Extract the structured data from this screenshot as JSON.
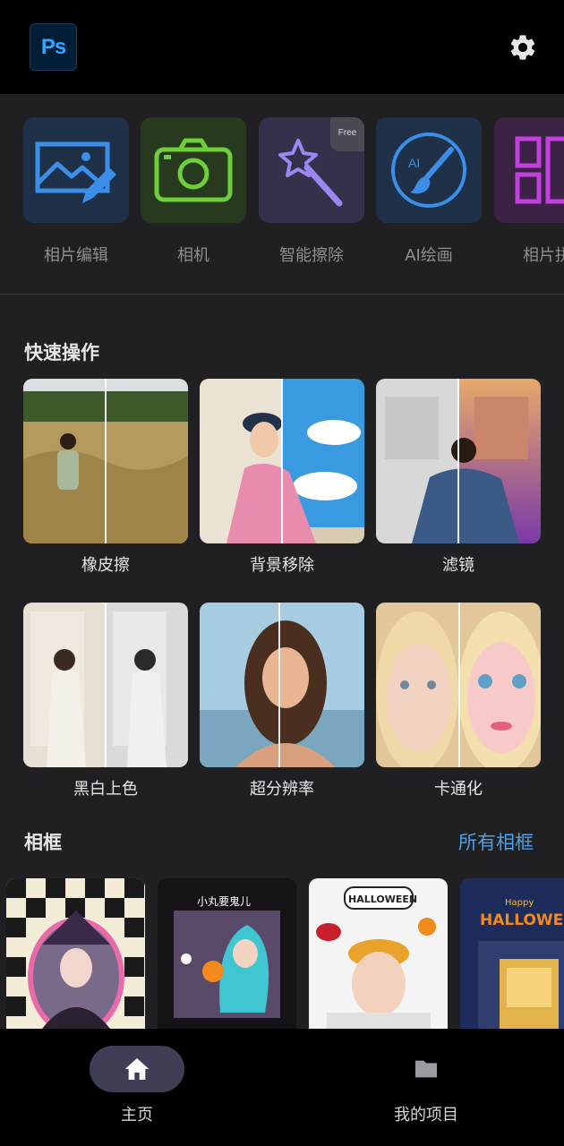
{
  "app": {
    "logo_text": "Ps"
  },
  "header": {
    "settings_icon": "gear-icon"
  },
  "tools": [
    {
      "label": "相片编辑",
      "icon": "photo-edit-icon",
      "color": "#3b8fe8"
    },
    {
      "label": "相机",
      "icon": "camera-icon",
      "color": "#6fcf3b"
    },
    {
      "label": "智能擦除",
      "icon": "magic-wand-icon",
      "color": "#9b86f2",
      "badge": "Free"
    },
    {
      "label": "AI绘画",
      "icon": "ai-brush-icon",
      "color": "#3b8fe8"
    },
    {
      "label": "相片拼",
      "icon": "collage-icon",
      "color": "#c53fe0"
    }
  ],
  "quick_actions": {
    "title": "快速操作",
    "items": [
      {
        "label": "橡皮擦"
      },
      {
        "label": "背景移除"
      },
      {
        "label": "滤镜"
      },
      {
        "label": "黑白上色"
      },
      {
        "label": "超分辨率"
      },
      {
        "label": "卡通化"
      }
    ]
  },
  "frames": {
    "title": "相框",
    "see_all": "所有相框",
    "items": [
      {
        "caption": ""
      },
      {
        "caption": "小丸要鬼儿"
      },
      {
        "caption": "HALLOWEEN"
      },
      {
        "caption": "HALLOWEE",
        "subcaption": "Happy"
      }
    ]
  },
  "bottom_nav": {
    "home": "主页",
    "projects": "我的项目"
  },
  "colors": {
    "accent_link": "#4f9fe6",
    "background": "#202022",
    "bar": "#000000"
  }
}
